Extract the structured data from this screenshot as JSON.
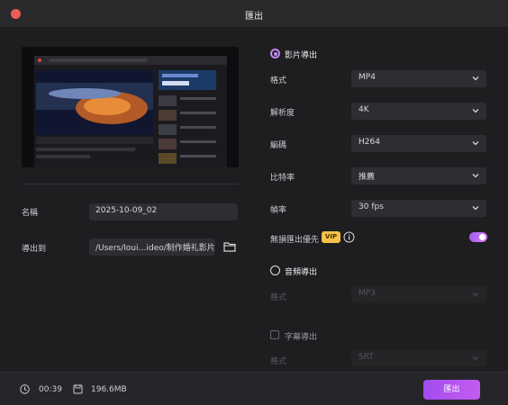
{
  "window": {
    "title": "匯出"
  },
  "left": {
    "name_label": "名稱",
    "name_value": "2025-10-09_02",
    "export_to_label": "導出到",
    "export_path": "/Users/loui…ideo/制作婚礼影片"
  },
  "video": {
    "section_title": "影片導出",
    "format_label": "格式",
    "format_value": "MP4",
    "resolution_label": "解析度",
    "resolution_value": "4K",
    "encoder_label": "編碼",
    "encoder_value": "H264",
    "bitrate_label": "比特率",
    "bitrate_value": "推薦",
    "framerate_label": "幀率",
    "framerate_value": "30  fps",
    "lossless_label": "無損匯出優先",
    "vip_badge": "VIP"
  },
  "audio": {
    "section_title": "音頻導出",
    "format_label": "格式",
    "format_value": "MP3"
  },
  "subtitle": {
    "section_title": "字幕導出",
    "format_label": "格式",
    "format_value": "SRT"
  },
  "footer": {
    "duration": "00:39",
    "size": "196.6MB",
    "export_button": "匯出"
  },
  "colors": {
    "accent": "#b25cf0",
    "background": "#1e1e21",
    "vip": "#f6c24b"
  }
}
